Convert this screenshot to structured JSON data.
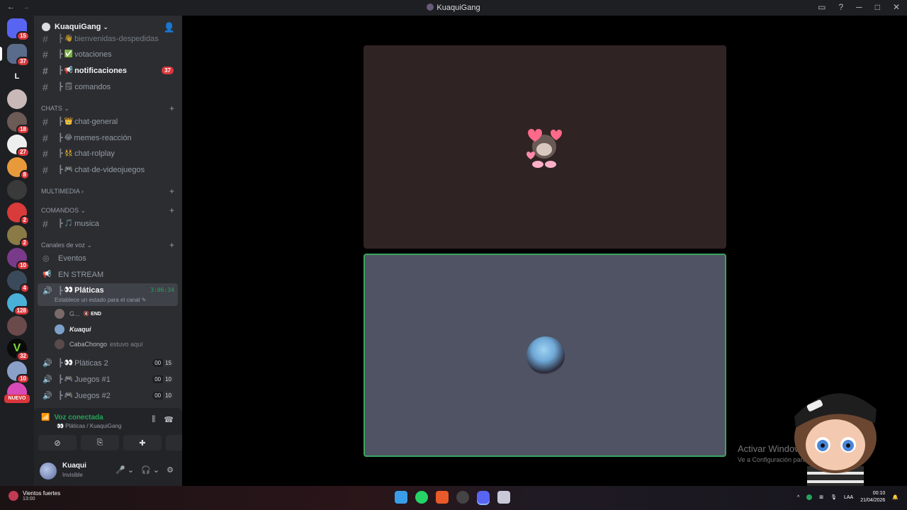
{
  "window": {
    "title": "KuaquiGang",
    "nav_back": "←",
    "nav_fwd": "→",
    "ctrl_inbox": "▭",
    "ctrl_help": "?",
    "ctrl_min": "─",
    "ctrl_max": "□",
    "ctrl_close": "✕"
  },
  "server": {
    "name": "KuaquiGang",
    "chev": "⌄",
    "add_friend": "👤"
  },
  "guild_badges": [
    "15",
    "37",
    "18",
    "27",
    "8",
    "2",
    "2",
    "10",
    "4",
    "128",
    "32",
    "10"
  ],
  "guild_new": "NUEVO",
  "guild_letter": "L",
  "channels_top": [
    {
      "name": "bienvenidas-despedidas",
      "emoji": "👋",
      "hash": "#"
    },
    {
      "name": "votaciones",
      "emoji": "✅",
      "hash": "#"
    },
    {
      "name": "notificaciones",
      "emoji": "📢",
      "hash": "#",
      "count": "37"
    },
    {
      "name": "comandos",
      "emoji": "🗒",
      "hash": "#"
    }
  ],
  "categories": {
    "chats": "CHATS ⌄",
    "multimedia": "MULTIMEDIA ›",
    "comandos": "COMANDOS ⌄",
    "voz": "Canales de voz ⌄",
    "plus": "+"
  },
  "channels_chat": [
    {
      "name": "chat-general",
      "emoji": "👑"
    },
    {
      "name": "memes-reacción",
      "emoji": "😂"
    },
    {
      "name": "chat-rolplay",
      "emoji": "👯"
    },
    {
      "name": "chat-de-videojuegos",
      "emoji": "🎮"
    }
  ],
  "channel_musica": {
    "name": "musica",
    "emoji": "🎵"
  },
  "voice_misc": [
    {
      "name": "Eventos",
      "icon": "◎"
    },
    {
      "name": "EN STREAM",
      "icon": "📢"
    }
  ],
  "voice_active": {
    "name": "Pláticas",
    "emoji": "👀",
    "time": "3:06:34",
    "status": "Establece un estado para el canal ✎"
  },
  "voice_users": [
    {
      "name": "G...",
      "tag": "🔇 END"
    },
    {
      "name": "Kuaqui"
    },
    {
      "name": "CabaChongo",
      "extra": "estuvo aquí"
    }
  ],
  "voice_channels": [
    {
      "name": "Pláticas 2",
      "emoji": "👀",
      "a": "00",
      "b": "15"
    },
    {
      "name": "Juegos #1",
      "emoji": "🎮",
      "a": "00",
      "b": "10"
    },
    {
      "name": "Juegos #2",
      "emoji": "🎮",
      "a": "00",
      "b": "10"
    }
  ],
  "voice_panel": {
    "title": "Voz conectada",
    "sub": "👀 Pláticas / KuaquiGang",
    "wave": "⫼",
    "hangup": "☎",
    "btn_cam": "⊘",
    "btn_share": "⎘",
    "btn_act": "✚",
    "btn_sound": "♪"
  },
  "user": {
    "name": "Kuaqui",
    "status": "Invisible",
    "mic": "🎤 ⌄",
    "head": "🎧 ⌄",
    "gear": "⚙"
  },
  "watermark": {
    "title": "Activar Windows",
    "sub": "Ve a Configuración para activar Windows."
  },
  "taskbar": {
    "weather": "Vientos fuertes",
    "weather_time": "13:00",
    "lang": "LAA",
    "time": "00:10",
    "date": "21/04/2026",
    "chevron": "^"
  }
}
